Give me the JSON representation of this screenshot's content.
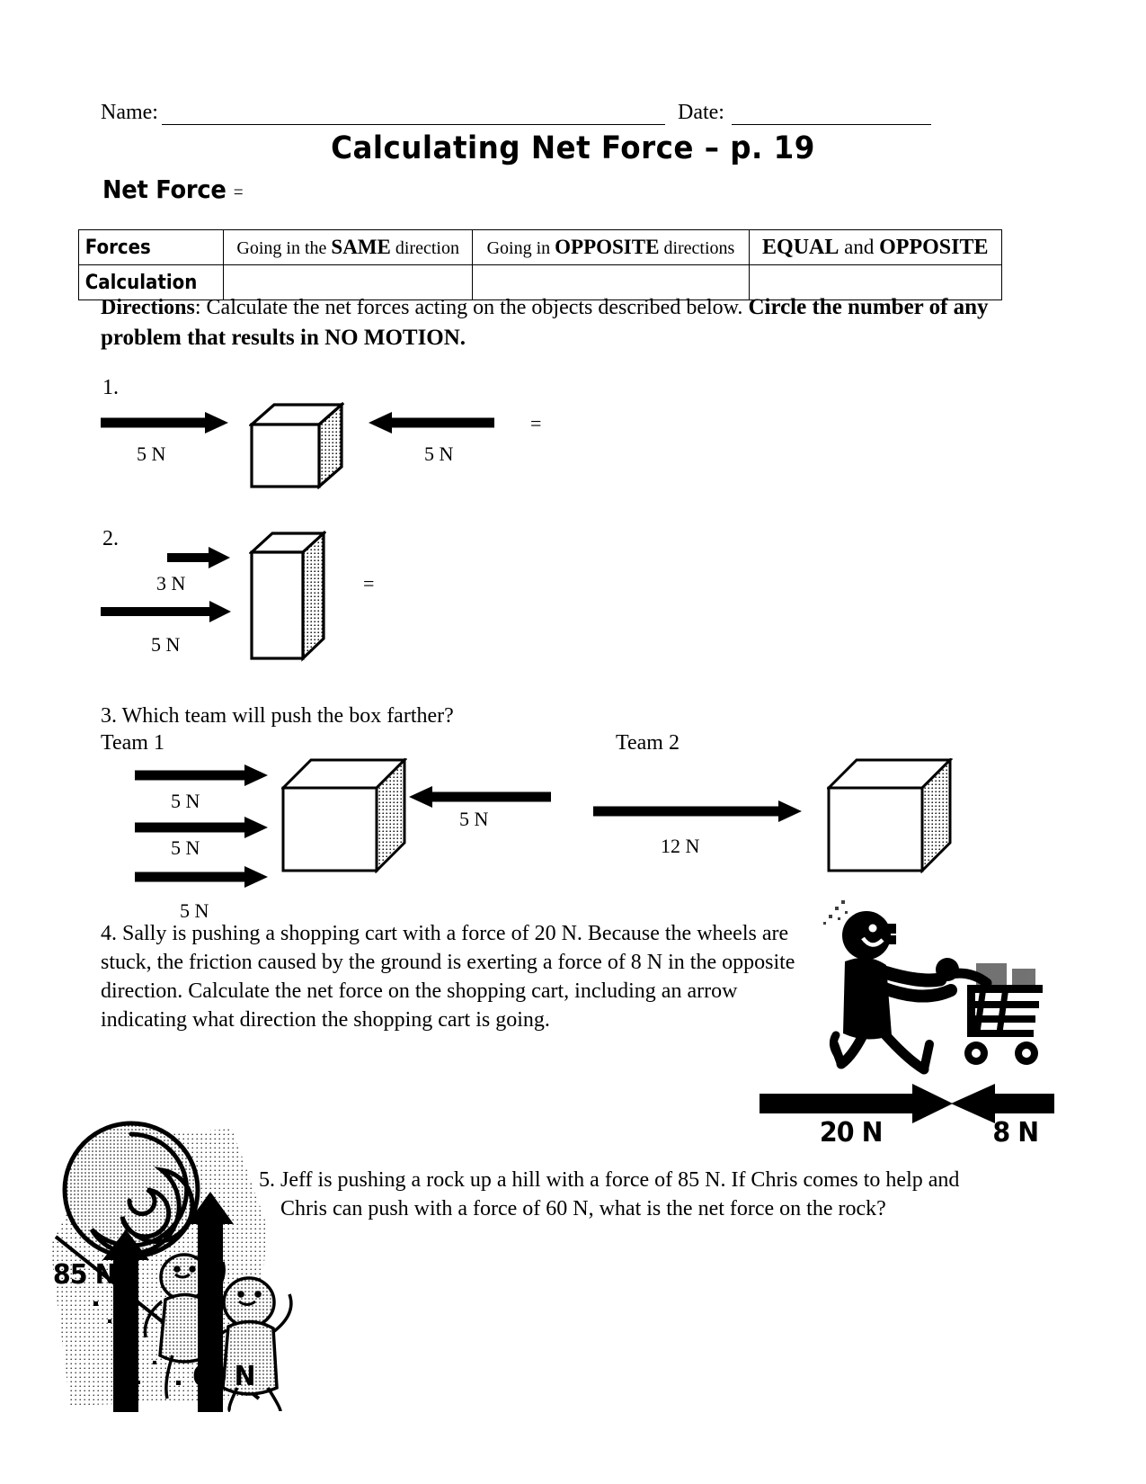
{
  "header": {
    "name_label": "Name:",
    "date_label": "Date:",
    "title": "Calculating Net Force – p. 19",
    "net_force_label": "Net Force",
    "net_force_equals": "="
  },
  "table": {
    "row_labels": [
      "Forces",
      "Calculation"
    ],
    "columns": [
      {
        "prefix": "Going in the ",
        "strong": "SAME",
        "suffix": " direction"
      },
      {
        "prefix": "Going in ",
        "strong": "OPPOSITE",
        "suffix": " directions"
      },
      {
        "prefix": "",
        "strong": "EQUAL",
        "mid": " and ",
        "strong2": "OPPOSITE",
        "suffix": ""
      }
    ],
    "calculation_cells": [
      "",
      "",
      ""
    ]
  },
  "directions": {
    "label": "Directions",
    "colon": ": ",
    "text": "Calculate the net forces acting on the objects described below. ",
    "emphasis": "Circle the number of any problem that results in NO MOTION."
  },
  "problems": [
    {
      "number": "1.",
      "left_force": "5 N",
      "right_force": "5 N",
      "equals": "="
    },
    {
      "number": "2.",
      "top_force": "3 N",
      "bottom_force": "5 N",
      "equals": "="
    },
    {
      "number": "3.",
      "question": "Which team will push the box farther?",
      "team1_label": "Team 1",
      "team2_label": "Team 2",
      "team1_forces": [
        "5 N",
        "5 N",
        "5 N"
      ],
      "team1_opposing": "5 N",
      "team2_force": "12 N"
    },
    {
      "number": "4.",
      "text": "Sally is pushing a shopping cart with a force of 20 N.  Because the wheels are stuck, the friction caused by the ground is exerting a force of 8 N in the opposite direction.  Calculate the net force on the shopping cart, including an arrow indicating what direction the shopping cart is going.",
      "push_force": "20 N",
      "friction_force": "8 N"
    },
    {
      "number": "5.",
      "text_line1": "Jeff is pushing a rock up a hill with a force of 85 N.  If Chris comes to help and",
      "text_line2": "Chris can push with a force of 60 N, what is the net force on the rock?",
      "jeff_force": "85 N",
      "chris_force": "60 N"
    }
  ],
  "colors": {
    "ink": "#000000",
    "paper": "#ffffff",
    "shade": "#d9d9d9"
  }
}
